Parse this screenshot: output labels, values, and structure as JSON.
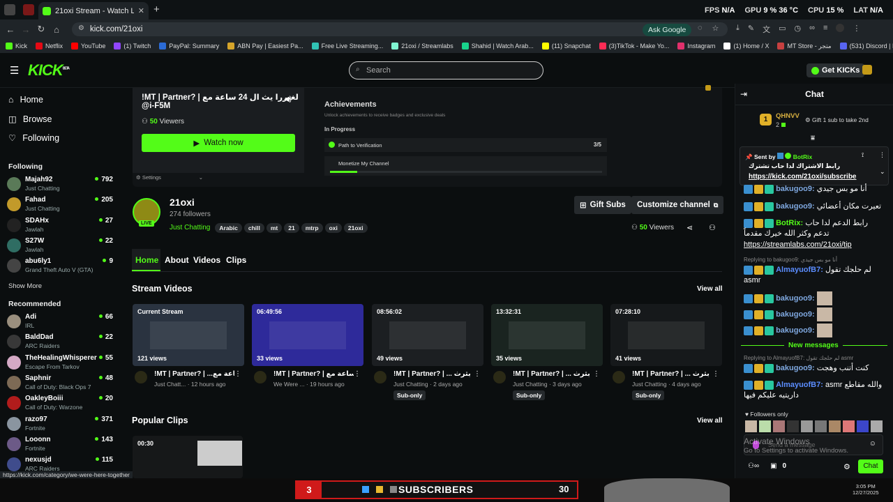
{
  "browser": {
    "tab_title": "21oxi Stream - Watch Live on Kick",
    "url": "kick.com/21oxi",
    "ask_google": "Ask Google",
    "new_tab": "+",
    "stats": [
      {
        "label": "FPS",
        "value": "N/A"
      },
      {
        "label": "GPU",
        "value": "9 %"
      },
      {
        "label": "",
        "value": "36 °C"
      },
      {
        "label": "CPU",
        "value": "15 %"
      },
      {
        "label": "LAT",
        "value": "N/A"
      }
    ],
    "bookmarks": [
      {
        "label": "Kick",
        "color": "#53fc18"
      },
      {
        "label": "Netflix",
        "color": "#e50914"
      },
      {
        "label": "YouTube",
        "color": "#ff0000"
      },
      {
        "label": "(1) Twitch",
        "color": "#9146ff"
      },
      {
        "label": "PayPal: Summary",
        "color": "#2b6bd6"
      },
      {
        "label": "ABN Pay | Easiest Pa...",
        "color": "#d6a52b"
      },
      {
        "label": "Free Live Streaming...",
        "color": "#31c3b4"
      },
      {
        "label": "21oxi / Streamlabs",
        "color": "#80f5d2"
      },
      {
        "label": "Shahid | Watch Arab...",
        "color": "#18d48c"
      },
      {
        "label": "(11) Snapchat",
        "color": "#fffc00"
      },
      {
        "label": "(3)TikTok - Make Yo...",
        "color": "#fe2c55"
      },
      {
        "label": "Instagram",
        "color": "#e1306c"
      },
      {
        "label": "(1) Home / X",
        "color": "#ffffff"
      },
      {
        "label": "MT Store - متجر",
        "color": "#c74040"
      },
      {
        "label": "(531) Discord | Frien...",
        "color": "#5865f2"
      }
    ]
  },
  "header": {
    "logo": "KICK",
    "beta": "BETA",
    "search_placeholder": "Search",
    "get_kicks": "Get KICKs"
  },
  "sidebar": {
    "nav": [
      {
        "label": "Home",
        "icon": "home-icon"
      },
      {
        "label": "Browse",
        "icon": "browse-icon"
      },
      {
        "label": "Following",
        "icon": "heart-icon"
      }
    ],
    "following_title": "Following",
    "following": [
      {
        "name": "Majah92",
        "cat": "Just Chatting",
        "viewers": "792",
        "color": "#5a7a58"
      },
      {
        "name": "Fahad",
        "cat": "Just Chatting",
        "viewers": "205",
        "color": "#c29a2a"
      },
      {
        "name": "SDAHx",
        "cat": "Jawlah",
        "viewers": "27",
        "color": "#222"
      },
      {
        "name": "S27W",
        "cat": "Jawlah",
        "viewers": "22",
        "color": "#2f6d63"
      },
      {
        "name": "abu6ly1",
        "cat": "Grand Theft Auto V (GTA)",
        "viewers": "9",
        "color": "#444"
      }
    ],
    "show_more": "Show More",
    "recommended_title": "Recommended",
    "recommended": [
      {
        "name": "Adi",
        "cat": "IRL",
        "viewers": "66",
        "color": "#9a8f7e"
      },
      {
        "name": "BaldDad",
        "cat": "ARC Raiders",
        "viewers": "22",
        "color": "#383838"
      },
      {
        "name": "TheHealingWhisperer",
        "cat": "Escape From Tarkov",
        "viewers": "55",
        "color": "#d4a9c5"
      },
      {
        "name": "Saphnir",
        "cat": "Call of Duty: Black Ops 7",
        "viewers": "48",
        "color": "#7d6a55"
      },
      {
        "name": "OakleyBoiii",
        "cat": "Call of Duty: Warzone",
        "viewers": "20",
        "color": "#b11c1c"
      },
      {
        "name": "razo97",
        "cat": "Fortnite",
        "viewers": "371",
        "color": "#8a95a0"
      },
      {
        "name": "Looonn",
        "cat": "Fortnite",
        "viewers": "143",
        "color": "#6c5a87"
      },
      {
        "name": "nexusjd",
        "cat": "ARC Raiders",
        "viewers": "115",
        "color": "#3f4c8c"
      }
    ]
  },
  "player": {
    "preview_title": "!MT | Partner? | لغيررا يث ال 24 ساعة مع",
    "preview_handle": "@i-F5M",
    "preview_viewers": "50",
    "viewers_label": "Viewers",
    "watch_now": "Watch now",
    "settings": "Settings",
    "achievements_title": "Achievements",
    "achievements_sub": "Unlock achievements to receive badges and exclusive deals",
    "in_progress": "In Progress",
    "ach1": "Path to Verification",
    "ach1_count": "3/5",
    "ach2": "Monetize My Channel",
    "ach1_progress": 0.6,
    "ach2_progress": 0.1
  },
  "channel": {
    "name": "21oxi",
    "followers": "274 followers",
    "live": "LIVE",
    "category": "Just Chatting",
    "tags": [
      "Arabic",
      "chill",
      "mt",
      "21",
      "mtrp",
      "oxi",
      "21oxi"
    ],
    "gift_subs": "Gift Subs",
    "customize": "Customize channel",
    "viewers": "50",
    "viewers_label": "Viewers"
  },
  "tabs": [
    "Home",
    "About",
    "Videos",
    "Clips"
  ],
  "stream_videos": {
    "title": "Stream Videos",
    "view_all": "View all",
    "items": [
      {
        "dur": "Current Stream",
        "views": "121 views",
        "title": "!MT | Partner? | ...ساعة مع",
        "meta": "Just Chatt... · 12 hours ago",
        "sub": "",
        "theme": "#2a3340"
      },
      {
        "dur": "06:49:56",
        "views": "33 views",
        "title": "!MT | Partner? | ساعة مع...",
        "meta": "We Were ... · 19 hours ago",
        "sub": "",
        "theme": "#2e2a9a"
      },
      {
        "dur": "08:56:02",
        "views": "49 views",
        "title": "!MT | Partner? | ... بثرث",
        "meta": "Just Chatting · 2 days ago",
        "sub": "Sub-only",
        "theme": "#1c1f22"
      },
      {
        "dur": "13:32:31",
        "views": "35 views",
        "title": "!MT | Partner? | ... بثرث",
        "meta": "Just Chatting · 3 days ago",
        "sub": "Sub-only",
        "theme": "#1a2420"
      },
      {
        "dur": "07:28:10",
        "views": "41 views",
        "title": "!MT | Partner? | ... بثرث",
        "meta": "Just Chatting · 4 days ago",
        "sub": "Sub-only",
        "theme": "#16191b"
      }
    ]
  },
  "popular_clips": {
    "title": "Popular Clips",
    "view_all": "View all",
    "items": [
      {
        "dur": "00:30"
      }
    ]
  },
  "chat": {
    "title": "Chat",
    "top_gifter": "QHNVV",
    "top_rank": "1",
    "top_count": "2",
    "gift_prompt": "Gift 1 sub to take 2nd",
    "pinned": {
      "sent_by": "Sent by",
      "user": "BotRix",
      "text": "رابط الاشتراك لدا حاب تشترك",
      "link": "https://kick.com/21oxi/subscribe"
    },
    "messages": [
      {
        "user": "bakugoo9:",
        "text": "أنا مو بس جيدي",
        "color": "#7fa8e0",
        "reply": ""
      },
      {
        "user": "bakugoo9:",
        "text": "تعيرت مكان أعضائي",
        "color": "#7fa8e0",
        "reply": ""
      },
      {
        "user": "BotRix:",
        "text": "رابط الدعم لدا حاب تدعم وكثر الله خيرك مقدماً",
        "color": "#53fc18",
        "reply": "",
        "link": "https://streamlabs.com/21oxi/tip"
      },
      {
        "user": "AlmayuofB7:",
        "text": "لم حلجك تقول asmr",
        "color": "#5b8dff",
        "reply": "Replying to bakugoo9: أنا مو بس جيدي"
      },
      {
        "user": "bakugoo9:",
        "text": "",
        "color": "#7fa8e0",
        "reply": ""
      },
      {
        "user": "bakugoo9:",
        "text": "",
        "color": "#7fa8e0",
        "reply": ""
      },
      {
        "user": "bakugoo9:",
        "text": "",
        "color": "#7fa8e0",
        "reply": ""
      }
    ],
    "new_messages": "New messages",
    "after": [
      {
        "user": "bakugoo9:",
        "text": "كنت أتنب وهجت",
        "color": "#7fa8e0",
        "reply": "Replying to AlmayuofB7: لم حلجك تقول asmr"
      },
      {
        "user": "AlmayuofB7:",
        "text": "asmr والله مقاطع داريتيه عليكم فيها",
        "color": "#5b8dff",
        "reply": ""
      }
    ],
    "followers_only": "Followers only",
    "send_placeholder": "Send a message",
    "points": "0",
    "chat_button": "Chat"
  },
  "windows": {
    "activate_title": "Activate Windows",
    "activate_sub": "Go to Settings to activate Windows.",
    "time": "3:05 PM",
    "date": "12/27/2025",
    "overlay_subs": "SUBSCRIBERS",
    "overlay_left": "3",
    "overlay_right": "30"
  },
  "status_url": "https://kick.com/category/we-were-here-together"
}
